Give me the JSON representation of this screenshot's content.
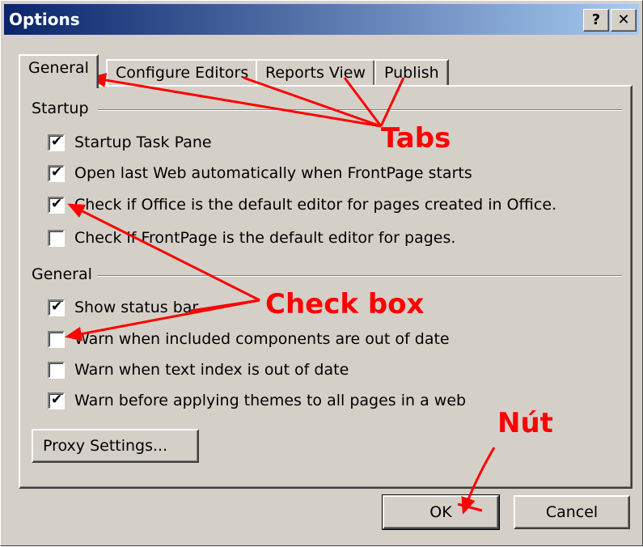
{
  "window": {
    "title": "Options",
    "help_label": "?",
    "close_label": "✕"
  },
  "tabs": [
    {
      "label": "General",
      "active": true
    },
    {
      "label": "Configure Editors",
      "active": false
    },
    {
      "label": "Reports View",
      "active": false
    },
    {
      "label": "Publish",
      "active": false
    }
  ],
  "startup": {
    "label": "Startup",
    "items": [
      {
        "label": "Startup Task Pane",
        "checked": true
      },
      {
        "label": "Open last Web automatically when FrontPage starts",
        "checked": true
      },
      {
        "label": "Check if Office is the default editor for pages created in Office.",
        "checked": true
      },
      {
        "label": "Check if FrontPage is the default editor for pages.",
        "checked": false
      }
    ]
  },
  "general": {
    "label": "General",
    "items": [
      {
        "label": "Show status bar",
        "checked": true
      },
      {
        "label": "Warn when included components are out of date",
        "checked": false
      },
      {
        "label": "Warn when text index is out of date",
        "checked": false
      },
      {
        "label": "Warn before applying themes to all pages in a web",
        "checked": true
      }
    ]
  },
  "buttons": {
    "proxy": "Proxy Settings...",
    "ok": "OK",
    "cancel": "Cancel"
  },
  "annotations": {
    "tabs": "Tabs",
    "checkbox": "Check box",
    "button": "Nút",
    "color": "#ff0000"
  },
  "checkmark": "✔"
}
